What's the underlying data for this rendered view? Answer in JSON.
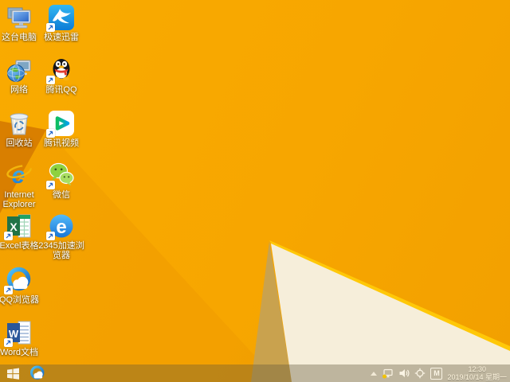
{
  "wallpaper": {
    "base": "#F7A600",
    "facet_dark": "#D97F00",
    "facet_mid": "#EE9900",
    "edge_highlight": "#FFC808",
    "tan_triangle": "#C9A24E",
    "cream_triangle": "#F6EEDA"
  },
  "desktop": {
    "icons": [
      {
        "id": "this-pc",
        "label": "这台电脑"
      },
      {
        "id": "xunlei",
        "label": "极速迅雷"
      },
      {
        "id": "network",
        "label": "网络"
      },
      {
        "id": "tencent-qq",
        "label": "腾讯QQ"
      },
      {
        "id": "recycle-bin",
        "label": "回收站"
      },
      {
        "id": "tencent-video",
        "label": "腾讯视频"
      },
      {
        "id": "internet-explorer",
        "label": "Internet",
        "label2": "Explorer"
      },
      {
        "id": "wechat",
        "label": "微信"
      },
      {
        "id": "excel",
        "label": "Excel表格"
      },
      {
        "id": "browser-2345",
        "label": "2345加速浏",
        "label2": "览器"
      },
      {
        "id": "qq-browser",
        "label": "QQ浏览器"
      },
      {
        "id": "word",
        "label": "Word文档"
      }
    ]
  },
  "taskbar": {
    "ime_indicator": "M",
    "clock": {
      "time": "12:30",
      "date": "2019/10/14 星期一"
    }
  }
}
